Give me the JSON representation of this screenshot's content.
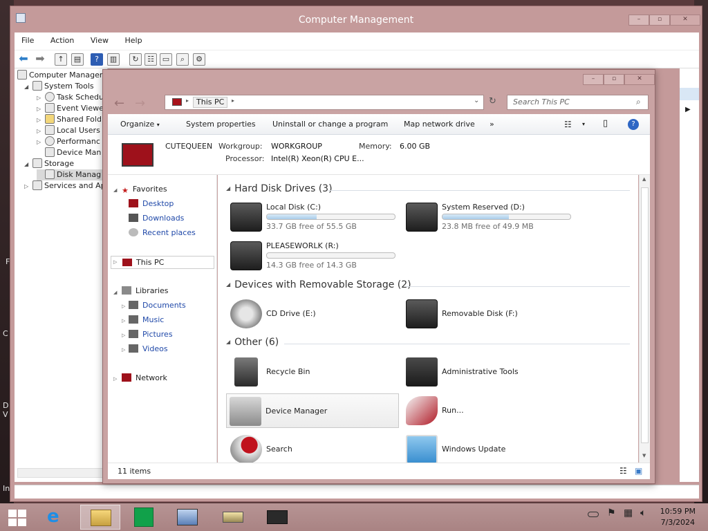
{
  "desktop": {
    "left_fragments": [
      "F",
      "C",
      "D\nV",
      "In"
    ]
  },
  "cm": {
    "title": "Computer Management",
    "menu": [
      "File",
      "Action",
      "View",
      "Help"
    ],
    "tree": [
      {
        "label": "Computer Manager",
        "arrow": "",
        "level": 0
      },
      {
        "label": "System Tools",
        "arrow": "◢",
        "level": 1
      },
      {
        "label": "Task Schedu",
        "arrow": "▷",
        "level": 2
      },
      {
        "label": "Event Viewe",
        "arrow": "▷",
        "level": 2
      },
      {
        "label": "Shared Fold",
        "arrow": "▷",
        "level": 2
      },
      {
        "label": "Local Users",
        "arrow": "▷",
        "level": 2
      },
      {
        "label": "Performanc",
        "arrow": "▷",
        "level": 2
      },
      {
        "label": "Device Man",
        "arrow": "",
        "level": 2
      },
      {
        "label": "Storage",
        "arrow": "◢",
        "level": 1
      },
      {
        "label": "Disk Manag",
        "arrow": "",
        "level": 2,
        "selected": true
      },
      {
        "label": "Services and Ap",
        "arrow": "▷",
        "level": 1
      }
    ]
  },
  "explorer": {
    "breadcrumb": "This PC",
    "search_placeholder": "Search This PC",
    "commands": [
      "Organize",
      "System properties",
      "Uninstall or change a program",
      "Map network drive",
      "»"
    ],
    "pc_name": "CUTEQUEEN",
    "details": {
      "workgroup_label": "Workgroup:",
      "workgroup": "WORKGROUP",
      "memory_label": "Memory:",
      "memory": "6.00 GB",
      "processor_label": "Processor:",
      "processor": "Intel(R) Xeon(R) CPU E..."
    },
    "nav": {
      "favorites": "Favorites",
      "fav_items": [
        "Desktop",
        "Downloads",
        "Recent places"
      ],
      "this_pc": "This PC",
      "libraries": "Libraries",
      "lib_items": [
        "Documents",
        "Music",
        "Pictures",
        "Videos"
      ],
      "network": "Network"
    },
    "groups": {
      "hdd": "Hard Disk Drives (3)",
      "removable": "Devices with Removable Storage (2)",
      "other": "Other (6)"
    },
    "drives": [
      {
        "name": "Local Disk (C:)",
        "free": "33.7 GB free of 55.5 GB",
        "used_fraction": 0.39
      },
      {
        "name": "System Reserved (D:)",
        "free": "23.8 MB free of 49.9 MB",
        "used_fraction": 0.52
      },
      {
        "name": "PLEASEWORLK (R:)",
        "free": "14.3 GB free of 14.3 GB",
        "used_fraction": 0.0
      }
    ],
    "removable": [
      "CD Drive (E:)",
      "Removable Disk (F:)"
    ],
    "other": [
      "Recycle Bin",
      "Administrative Tools",
      "Device Manager",
      "Run...",
      "Search",
      "Windows Update"
    ],
    "status": "11 items"
  },
  "taskbar": {
    "time": "10:59 PM",
    "date": "7/3/2024"
  },
  "colors": {
    "window_frame": "#c49a9a",
    "taskbar": "#b08b8b",
    "link_blue": "#1f48a8"
  }
}
